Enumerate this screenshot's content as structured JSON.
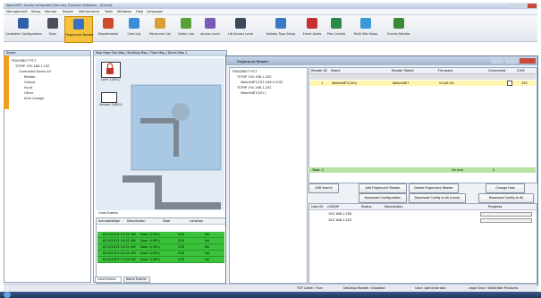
{
  "window_title": "WatchNET Access Integrated Security Systems Software - [Scene]",
  "menu": [
    "Management",
    "Setup",
    "Monitor",
    "Report",
    "Maintenance",
    "Tools",
    "Windows",
    "Help",
    "Language"
  ],
  "toolbar": [
    {
      "label": "Controller Configuration",
      "icon": "controller-icon",
      "color": "#2e5fa8"
    },
    {
      "label": "Door",
      "icon": "door-icon",
      "color": "#4a4f5a"
    },
    {
      "label": "Fingerprint Reader",
      "icon": "fingerprint-icon",
      "color": "#3a6fc4"
    },
    {
      "label": "Departments",
      "icon": "departments-icon",
      "color": "#d04a2c"
    },
    {
      "label": "Card List",
      "icon": "card-list-icon",
      "color": "#3a8ed8"
    },
    {
      "label": "Personnel List",
      "icon": "personnel-icon",
      "color": "#d8a030"
    },
    {
      "label": "Visitor List",
      "icon": "visitor-icon",
      "color": "#5aa03a"
    },
    {
      "label": "Access Level",
      "icon": "access-level-icon",
      "color": "#7a5ab8"
    },
    {
      "label": "Lift Access Level",
      "icon": "lift-icon",
      "color": "#3a4a5a"
    },
    {
      "label": "Holiday Type Setup",
      "icon": "holiday-icon",
      "color": "#3a78c8"
    },
    {
      "label": "Event Alerts",
      "icon": "event-alert-icon",
      "color": "#c83030"
    },
    {
      "label": "Plan Control",
      "icon": "plan-control-icon",
      "color": "#2a8a4a"
    },
    {
      "label": "Multi Site Setup",
      "icon": "multisite-icon",
      "color": "#3a9ad8"
    },
    {
      "label": "Events Monitor",
      "icon": "events-monitor-icon",
      "color": "#3a8a3a"
    }
  ],
  "left_panel": {
    "title": "Scene",
    "tree": [
      "FRAGEBOT PC7",
      "TCP/IP 192.168.1.100",
      "Controlled Doors All",
      "Reader",
      "Output",
      "Input",
      "Other",
      "Anti-Linkage"
    ]
  },
  "map_panel": {
    "breadcrumb": "Map Page  Site Map / Building Map / Floor Map / Demo Map 1",
    "lock1_label": "Lock 1(0R1)",
    "sensor_label": "Sensor 1(0R1)",
    "events_title": "Card Events",
    "events_columns": [
      "Acknowledge",
      "Description",
      "Door",
      "Location"
    ],
    "event_rows": [
      [
        "8/15/2013 14:31 AM",
        "Door 1(0R1)",
        "228",
        "No"
      ],
      [
        "8/15/2013 14:31 AM",
        "Door 1(0R1)",
        "228",
        "No"
      ],
      [
        "8/15/2013 14:31 AM",
        "Door 1(0R1)",
        "228",
        "No"
      ],
      [
        "8/15/2013 14:31 AM",
        "Door 1(0R1)",
        "228",
        "No"
      ],
      [
        "8/15/2013 17:50 AM",
        "Door 1(0R1)",
        "228",
        "No"
      ]
    ],
    "tab_card_events": "Card Events",
    "tab_alarm_events": "Alarm Events"
  },
  "fingerprint_window": {
    "title": "Fingerprint Reader",
    "tree": [
      "FRAGEBOT PC7",
      "TCP/IP 192.168.1.200",
      "WatchNET(192.168.0.200)",
      "TCP/IP 192.168.1.201",
      "WatchNET(201)"
    ],
    "columns": [
      "Reader ID",
      "Name",
      "Reader Model",
      "Firmware",
      "Connected",
      "COM"
    ],
    "rows": [
      [
        "1",
        "WatchNET(100)",
        "WatchNET",
        "V5.AE.V3",
        "",
        "192"
      ]
    ],
    "total_label": "Total: 2",
    "online_label": "On-line",
    "online_count": "2",
    "buttons_row1": [
      "USB Search",
      "Add Fingerprint Reader",
      "Delete Fingerprint Reader",
      "Change Host"
    ],
    "buttons_row2": [
      "Download Configuration",
      "Download Config to All (Local)",
      "Download Config to All"
    ],
    "lower_columns": [
      "User ID",
      "COM/IP",
      "Status",
      "Description",
      "Progress"
    ],
    "lower_rows": [
      [
        "",
        "192.168.1.200",
        "",
        ""
      ],
      [
        "",
        "192.168.1.202",
        "",
        ""
      ]
    ]
  },
  "status_bar": {
    "tcp": "TCP Listen: True",
    "desktop": "Desktop Reader: Disabled",
    "user": "User: Administrator",
    "legal": "Legal User: WatchNet Products"
  }
}
